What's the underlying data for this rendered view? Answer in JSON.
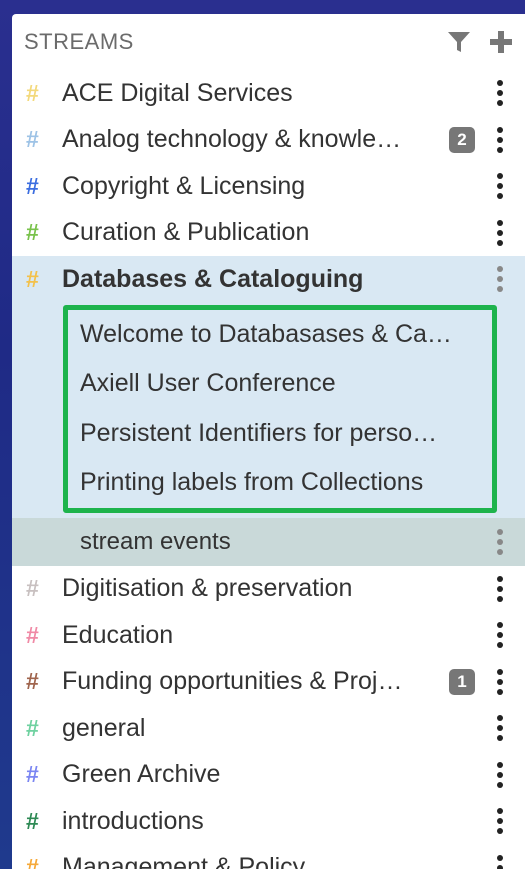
{
  "header": {
    "title": "STREAMS",
    "filter_icon": "filter-icon",
    "add_icon": "plus-icon"
  },
  "streams_before": [
    {
      "name": "ACE Digital Services",
      "color": "#f3d97c",
      "badge": null
    },
    {
      "name": "Analog technology & knowle…",
      "color": "#9ec3e6",
      "badge": "2"
    },
    {
      "name": "Copyright & Licensing",
      "color": "#3c6ee0",
      "badge": null
    },
    {
      "name": "Curation & Publication",
      "color": "#79c24b",
      "badge": null
    }
  ],
  "selected_stream": {
    "name": "Databases & Cataloguing",
    "color": "#f3c14b"
  },
  "topics": [
    "Welcome to Databasases & Ca…",
    "Axiell User Conference",
    "Persistent Identifiers for perso…",
    "Printing labels from Collections"
  ],
  "events_label": "stream events",
  "streams_after": [
    {
      "name": "Digitisation & preservation",
      "color": "#c8c0c0",
      "badge": null
    },
    {
      "name": "Education",
      "color": "#f08aa6",
      "badge": null
    },
    {
      "name": "Funding opportunities & Proj…",
      "color": "#a0654e",
      "badge": "1"
    },
    {
      "name": "general",
      "color": "#6fd1a0",
      "badge": null
    },
    {
      "name": "Green Archive",
      "color": "#7b86f2",
      "badge": null
    },
    {
      "name": "introductions",
      "color": "#2e8a55",
      "badge": null
    },
    {
      "name": "Management & Policy",
      "color": "#f5a93a",
      "badge": null
    }
  ]
}
